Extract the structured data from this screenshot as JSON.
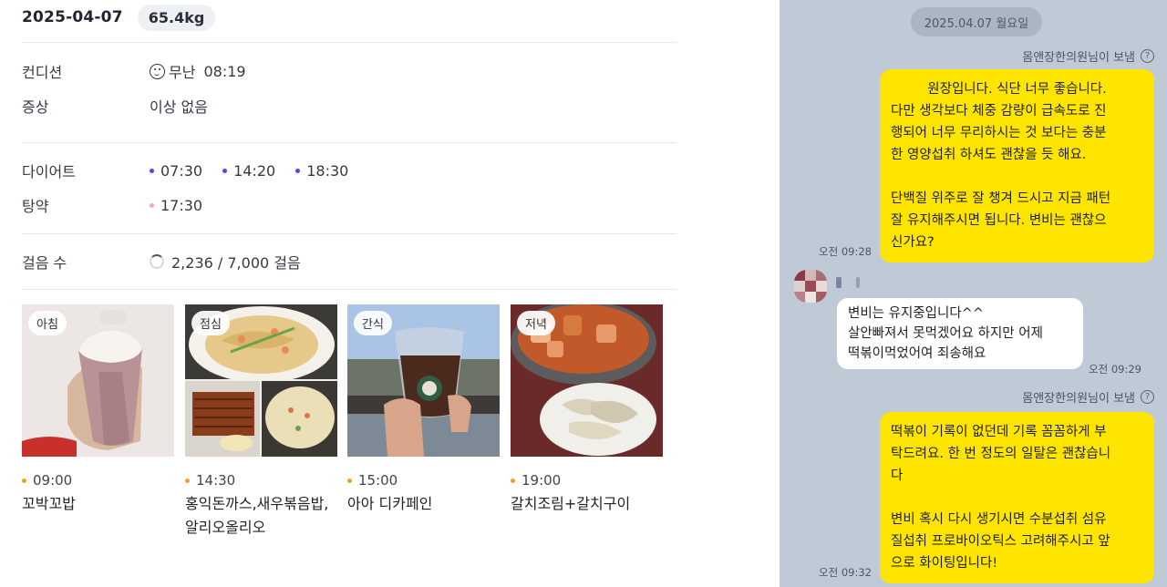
{
  "header": {
    "date": "2025-04-07",
    "weight": "65.4kg"
  },
  "condition": {
    "label": "컨디션",
    "value": "무난",
    "time": "08:19"
  },
  "symptom": {
    "label": "증상",
    "value": "이상 없음"
  },
  "diet": {
    "label": "다이어트",
    "times": [
      "07:30",
      "14:20",
      "18:30"
    ],
    "dot_color": "#6a3fd1"
  },
  "medicine": {
    "label": "탕약",
    "times": [
      "17:30"
    ],
    "dot_color": "#f0a6c8"
  },
  "steps": {
    "label": "걸음 수",
    "value": "2,236 / 7,000 걸음",
    "progress": 0.32
  },
  "meals": [
    {
      "tag": "아침",
      "time": "09:00",
      "name": "꼬박꼬밥"
    },
    {
      "tag": "점심",
      "time": "14:30",
      "name": "홍익돈까스,새우볶음밥,알리오올리오"
    },
    {
      "tag": "간식",
      "time": "15:00",
      "name": "아아 디카페인"
    },
    {
      "tag": "저녁",
      "time": "19:00",
      "name": "갈치조림+갈치구이"
    }
  ],
  "meal_dot_color": "#f0a11c",
  "chat": {
    "date": "2025.04.07 월요일",
    "sender_label": "몸앤장한의원님이 보냄",
    "msg1": {
      "lines": [
        "원장입니다. 식단 너무 좋습니다.",
        "다만 생각보다 체중 감량이 급속도로 진",
        "행되어 너무 무리하시는 것 보다는 충분",
        "한 영양섭취 하셔도 괜찮을 듯 해요.",
        "",
        "단백질 위주로 잘 챙겨 드시고 지금 패턴",
        "잘 유지해주시면 됩니다. 변비는 괜찮으",
        "신가요?"
      ],
      "time": "오전 09:28"
    },
    "msg2": {
      "lines": [
        "변비는 유지중입니다^^",
        "살안빠져서 못먹겠어요 하지만 어제",
        "떡볶이먹었어여 죄송해요"
      ],
      "time": "오전 09:29"
    },
    "msg3": {
      "lines": [
        "떡볶이 기록이 없던데 기록 꼼꼼하게 부",
        "탁드려요. 한 번 정도의 일탈은 괜찮습니",
        "다",
        "",
        "변비 혹시 다시 생기시면 수분섭취 섬유",
        "질섭취 프로바이오틱스 고려해주시고 앞",
        "으로 화이팅입니다!"
      ],
      "time": "오전 09:32"
    },
    "bubble_color": "#fee500",
    "bg_color": "#bfcad6"
  }
}
